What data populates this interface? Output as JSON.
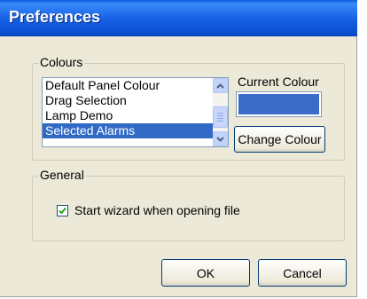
{
  "window": {
    "title": "Preferences"
  },
  "colours": {
    "group_label": "Colours",
    "items": [
      {
        "label": "Default Panel Colour",
        "selected": false
      },
      {
        "label": "Drag Selection",
        "selected": false
      },
      {
        "label": "Lamp Demo",
        "selected": false
      },
      {
        "label": "Selected Alarms",
        "selected": true
      }
    ],
    "current_colour_label": "Current Colour",
    "current_colour_value": "#3b6cc6",
    "change_button": "Change Colour"
  },
  "general": {
    "group_label": "General",
    "wizard_checkbox": {
      "label": "Start wizard when opening file",
      "checked": true
    }
  },
  "footer": {
    "ok_button": "OK",
    "cancel_button": "Cancel"
  },
  "icons": {
    "scroll_up": "chevron-up-icon",
    "scroll_down": "chevron-down-icon",
    "check": "checkmark-icon"
  }
}
